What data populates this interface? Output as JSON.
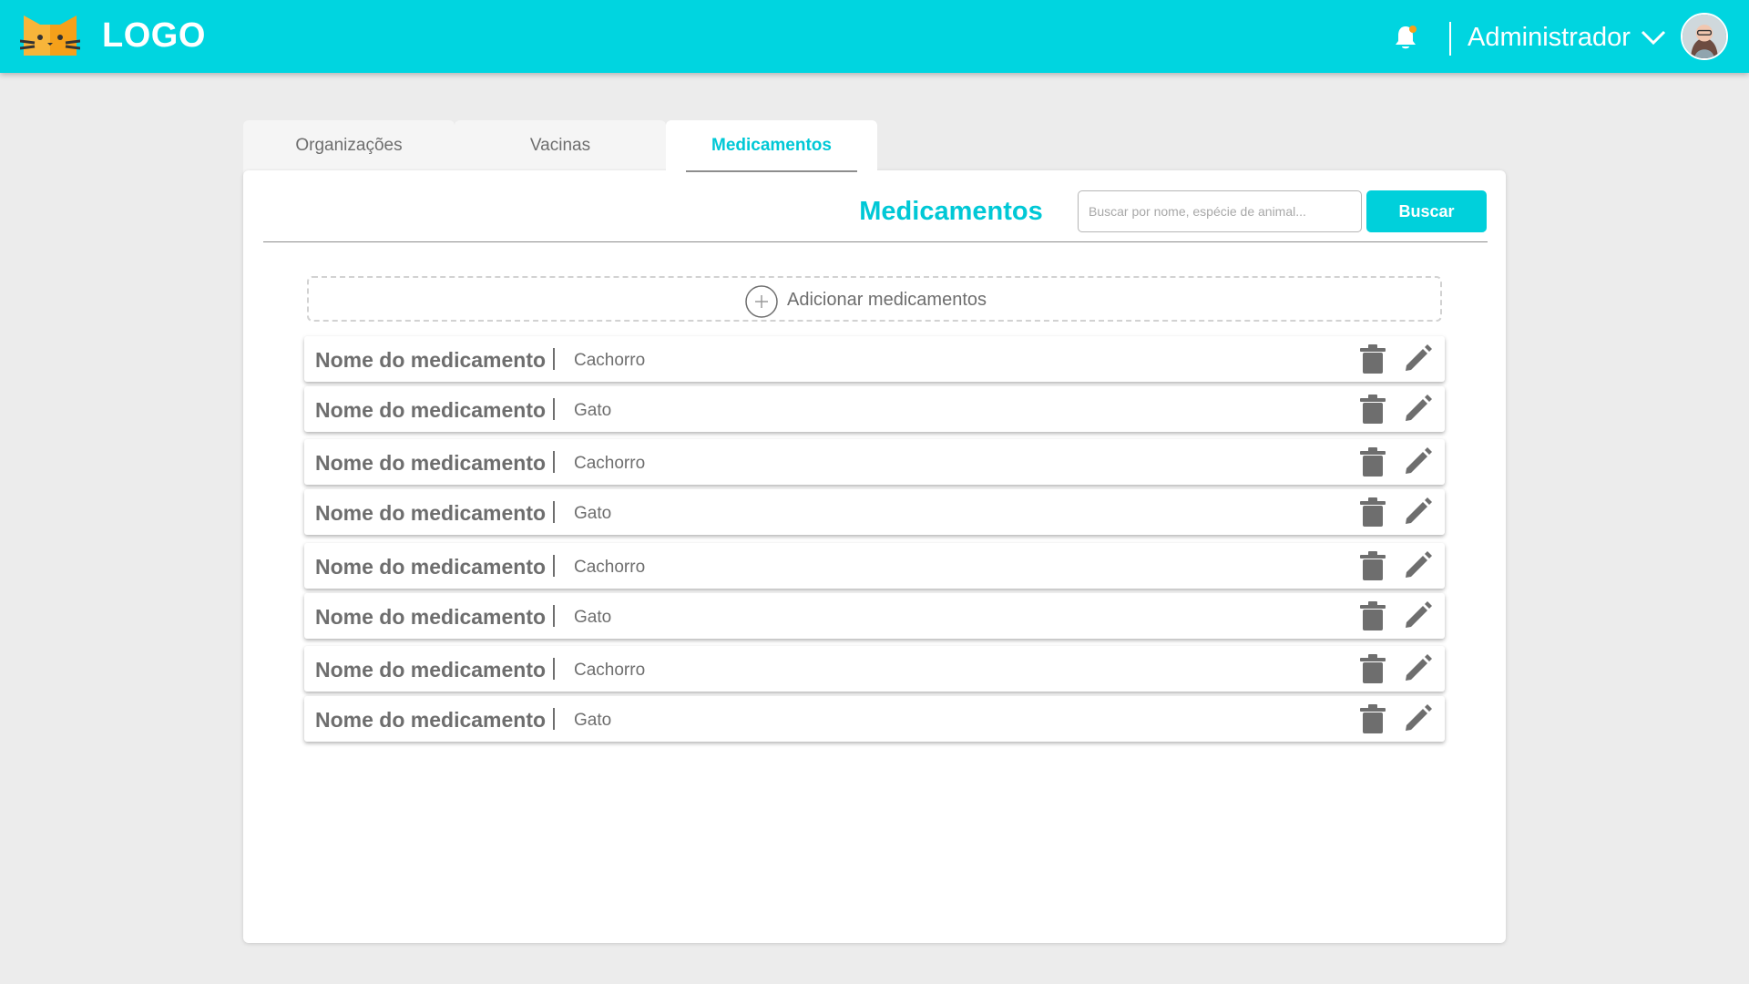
{
  "header": {
    "logo_text": "LOGO",
    "logo_icon": "cat-face-icon",
    "notification_icon": "bell-icon",
    "user_name": "Administrador",
    "user_menu_icon": "chevron-down-icon",
    "avatar": "user-avatar",
    "bar_color": "#00d5e0"
  },
  "tabs": [
    {
      "label": "Organizações",
      "active": false
    },
    {
      "label": "Vacinas",
      "active": false
    },
    {
      "label": "Medicamentos",
      "active": true
    }
  ],
  "main": {
    "title": "Medicamentos",
    "search": {
      "placeholder": "Buscar por nome, espécie de animal...",
      "value": ""
    },
    "search_button_label": "Buscar",
    "add_label": "Adicionar medicamentos",
    "add_icon": "plus-circle-icon",
    "accent_color": "#00c8d6",
    "items": [
      {
        "name": "Nome do medicamento",
        "species": "Cachorro"
      },
      {
        "name": "Nome do medicamento",
        "species": "Gato"
      },
      {
        "name": "Nome do medicamento",
        "species": "Cachorro"
      },
      {
        "name": "Nome do medicamento",
        "species": "Gato"
      },
      {
        "name": "Nome do medicamento",
        "species": "Cachorro"
      },
      {
        "name": "Nome do medicamento",
        "species": "Gato"
      },
      {
        "name": "Nome do medicamento",
        "species": "Cachorro"
      },
      {
        "name": "Nome do medicamento",
        "species": "Gato"
      }
    ],
    "row_icons": {
      "delete": "trash-icon",
      "edit": "pencil-icon"
    }
  }
}
